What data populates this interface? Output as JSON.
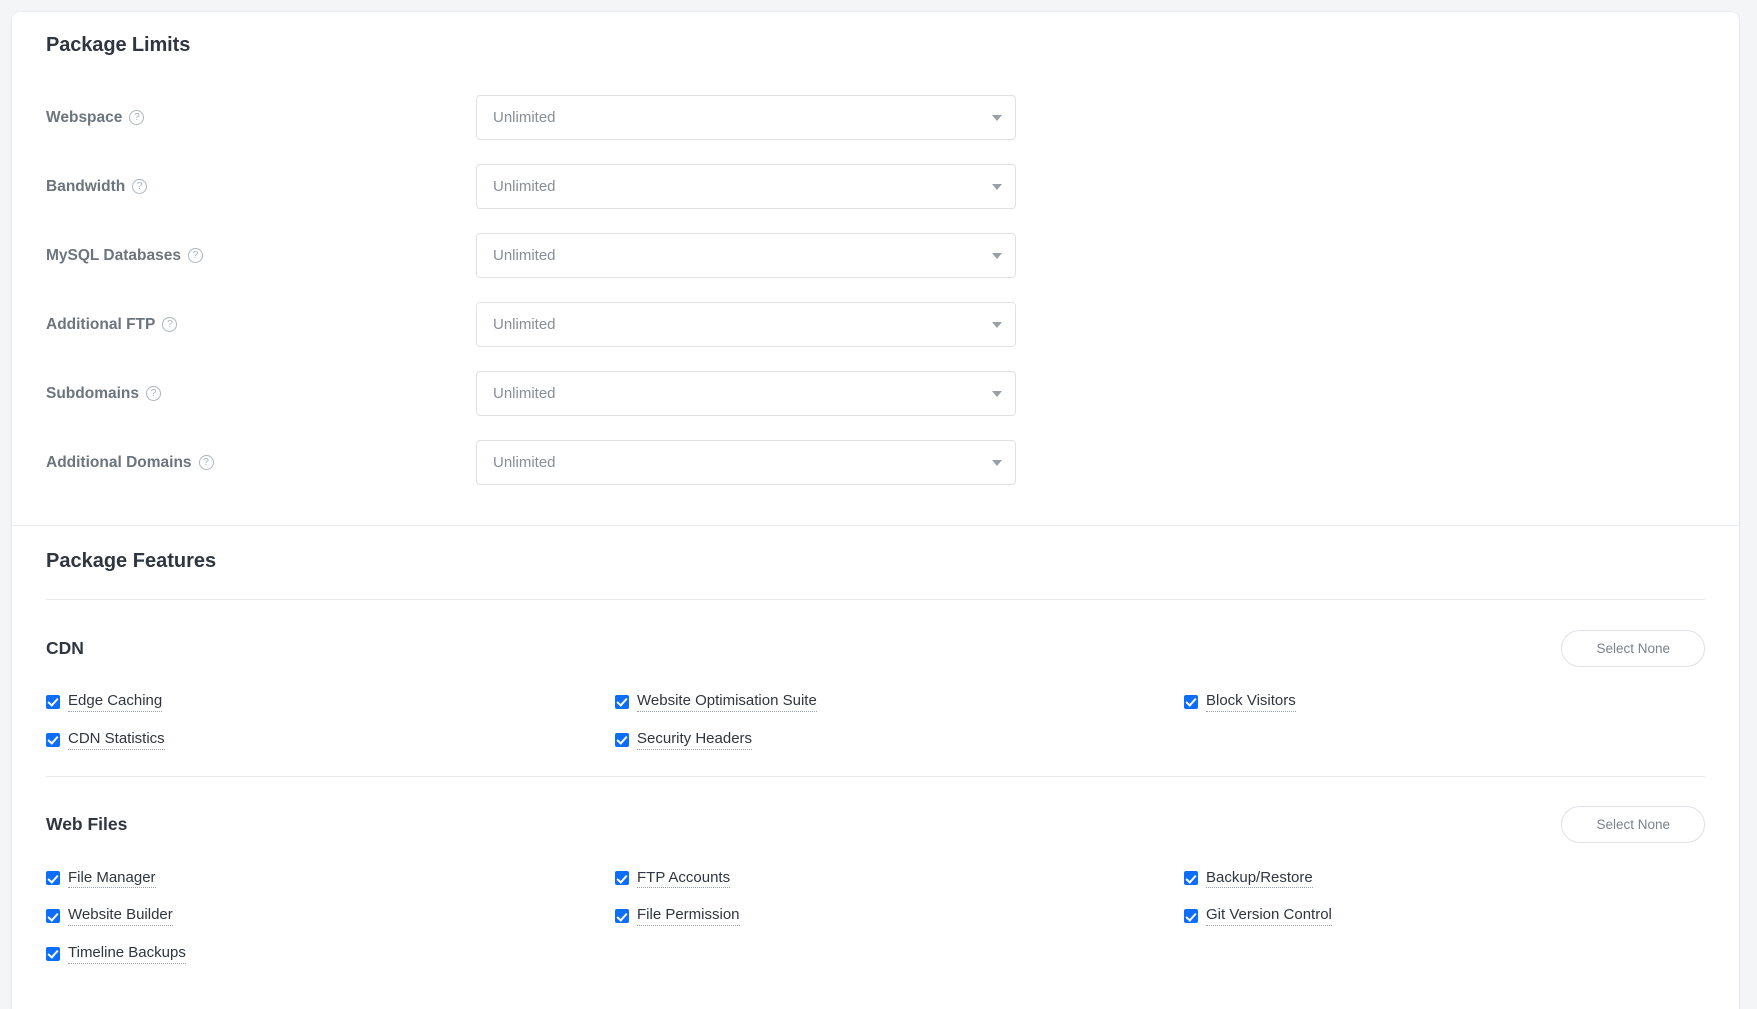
{
  "limits": {
    "title": "Package Limits",
    "help_icon": "help-circle-icon",
    "caret_icon": "chevron-down-icon",
    "rows": [
      {
        "label": "Webspace",
        "value": "Unlimited"
      },
      {
        "label": "Bandwidth",
        "value": "Unlimited"
      },
      {
        "label": "MySQL Databases",
        "value": "Unlimited"
      },
      {
        "label": "Additional FTP",
        "value": "Unlimited"
      },
      {
        "label": "Subdomains",
        "value": "Unlimited"
      },
      {
        "label": "Additional Domains",
        "value": "Unlimited"
      }
    ]
  },
  "features": {
    "title": "Package Features",
    "select_none_label": "Select None",
    "groups": [
      {
        "title": "CDN",
        "items": [
          "Edge Caching",
          "Website Optimisation Suite",
          "Block Visitors",
          "CDN Statistics",
          "Security Headers"
        ]
      },
      {
        "title": "Web Files",
        "items": [
          "File Manager",
          "FTP Accounts",
          "Backup/Restore",
          "Website Builder",
          "File Permission",
          "Git Version Control",
          "Timeline Backups"
        ]
      }
    ]
  },
  "colors": {
    "checkbox_blue": "#0d6efd",
    "heading": "#2f3640",
    "label_gray": "#6c757d",
    "border": "#dfe1e5",
    "page_bg": "#f4f5f7"
  }
}
